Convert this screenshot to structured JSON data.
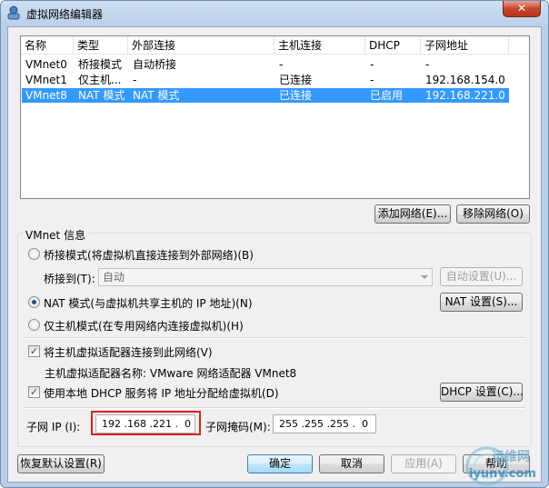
{
  "window": {
    "title": "虚拟网络编辑器",
    "close_label": "✕"
  },
  "table": {
    "headers": [
      "名称",
      "类型",
      "外部连接",
      "主机连接",
      "DHCP",
      "子网地址"
    ],
    "rows": [
      [
        "VMnet0",
        "桥接模式",
        "自动桥接",
        "-",
        "-",
        "-"
      ],
      [
        "VMnet1",
        "仅主机...",
        "-",
        "已连接",
        "-",
        "192.168.154.0"
      ],
      [
        "VMnet8",
        "NAT 模式",
        "NAT 模式",
        "已连接",
        "已启用",
        "192.168.221.0"
      ]
    ],
    "selected_row": 2
  },
  "buttons": {
    "add_network": "添加网络(E)...",
    "remove_network": "移除网络(O)",
    "auto_settings": "自动设置(U)...",
    "nat_settings": "NAT 设置(S)...",
    "dhcp_settings": "DHCP 设置(C)...",
    "restore_defaults": "恢复默认设置(R)",
    "ok": "确定",
    "cancel": "取消",
    "apply": "应用(A)",
    "help": "帮助"
  },
  "vmnet_info": {
    "group_label": "VMnet 信息",
    "bridge_mode": "桥接模式(将虚拟机直接连接到外部网络)(B)",
    "bridge_to_label": "桥接到(T):",
    "bridge_to_value": "自动",
    "nat_mode": "NAT 模式(与虚拟机共享主机的 IP 地址)(N)",
    "host_only_mode": "仅主机模式(在专用网络内连接虚拟机)(H)",
    "selected_mode": "nat",
    "connect_adapter": "将主机虚拟适配器连接到此网络(V)",
    "connect_adapter_checked": true,
    "adapter_name": "主机虚拟适配器名称: VMware 网络适配器 VMnet8",
    "use_dhcp": "使用本地 DHCP 服务将 IP 地址分配给虚拟机(D)",
    "use_dhcp_checked": true,
    "subnet_ip_label": "子网 IP (I):",
    "subnet_ip": "192 .168 .221 .  0",
    "subnet_mask_label": "子网掩码(M):",
    "subnet_mask": "255 .255 .255 .  0"
  },
  "watermark": {
    "line1": "运维网",
    "line2": "iyunv.com"
  }
}
